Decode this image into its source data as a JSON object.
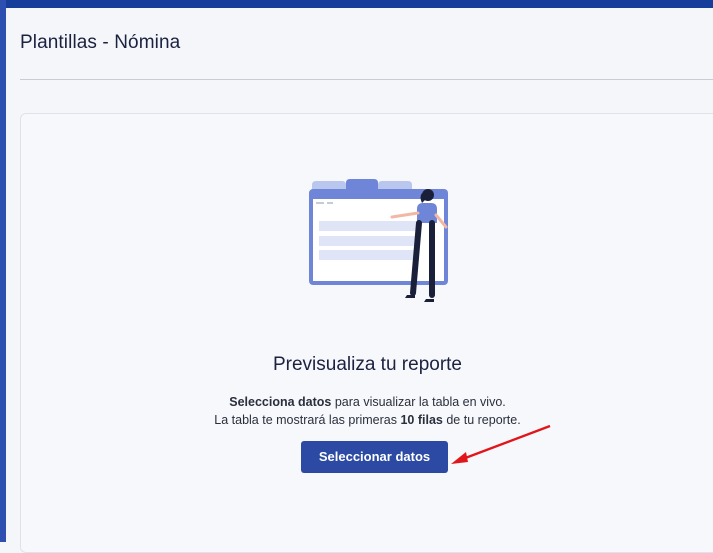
{
  "header": {
    "title": "Plantillas - Nómina"
  },
  "empty_state": {
    "illustration": "person-with-browser-window-illustration",
    "heading": "Previsualiza tu reporte",
    "line1_bold": "Selecciona datos",
    "line1_rest": " para visualizar la tabla en vivo.",
    "line2_prefix": "La tabla te mostrará las primeras ",
    "line2_bold": "10 filas",
    "line2_suffix": " de tu reporte.",
    "button_label": "Seleccionar datos"
  },
  "annotation": {
    "arrow_color": "#e0161b",
    "icon": "red-arrow-icon"
  },
  "colors": {
    "top_bar": "#173d9b",
    "accent": "#2c4aa3",
    "illustration_blue": "#6f86d8",
    "illustration_light": "#dfe5f6"
  }
}
